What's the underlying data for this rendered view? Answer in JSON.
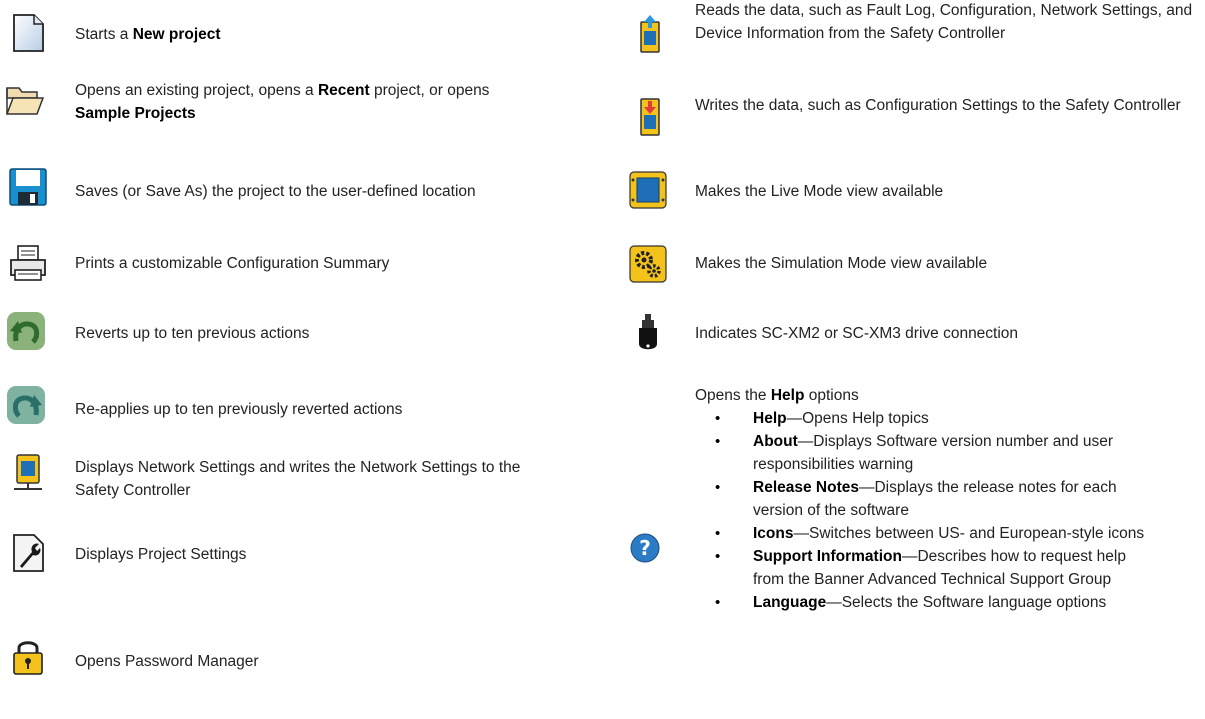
{
  "left": [
    {
      "icon": "new-file-icon",
      "parts": [
        {
          "t": "Starts a "
        },
        {
          "t": "New project",
          "b": true
        }
      ]
    },
    {
      "icon": "open-folder-icon",
      "parts": [
        {
          "t": "Opens an existing project, opens a "
        },
        {
          "t": "Recent",
          "b": true
        },
        {
          "t": " project, or opens "
        },
        {
          "t": "Sample Projects",
          "b": true
        }
      ]
    },
    {
      "icon": "save-disk-icon",
      "parts": [
        {
          "t": "Saves (or Save As) the project to the user-defined location"
        }
      ]
    },
    {
      "icon": "printer-icon",
      "parts": [
        {
          "t": "Prints a customizable Configuration Summary"
        }
      ]
    },
    {
      "icon": "undo-arrow-icon",
      "parts": [
        {
          "t": "Reverts up to ten previous actions"
        }
      ]
    },
    {
      "icon": "redo-arrow-icon",
      "parts": [
        {
          "t": "Re-applies up to ten previously reverted actions"
        }
      ]
    },
    {
      "icon": "network-device-icon",
      "parts": [
        {
          "t": "Displays Network Settings and writes the Network Settings to the Safety Controller"
        }
      ]
    },
    {
      "icon": "wrench-settings-icon",
      "parts": [
        {
          "t": "Displays Project Settings"
        }
      ]
    },
    {
      "icon": "padlock-icon",
      "parts": [
        {
          "t": "Opens Password Manager"
        }
      ]
    }
  ],
  "right": [
    {
      "icon": "read-controller-icon",
      "parts": [
        {
          "t": "Reads the data, such as Fault Log, Configuration, Network Settings, and Device Information from the Safety Controller"
        }
      ]
    },
    {
      "icon": "write-controller-icon",
      "parts": [
        {
          "t": "Writes the data, such as Configuration Settings to the Safety Controller"
        }
      ]
    },
    {
      "icon": "live-mode-icon",
      "parts": [
        {
          "t": "Makes the Live Mode view available"
        }
      ]
    },
    {
      "icon": "simulation-gears-icon",
      "parts": [
        {
          "t": "Makes the Simulation Mode view available"
        }
      ]
    },
    {
      "icon": "usb-drive-icon",
      "parts": [
        {
          "t": "Indicates SC-XM2 or SC-XM3 drive connection"
        }
      ]
    }
  ],
  "help": {
    "icon": "help-question-icon",
    "intro": [
      {
        "t": "Opens the "
      },
      {
        "t": "Help",
        "b": true
      },
      {
        "t": " options"
      }
    ],
    "items": [
      {
        "term": "Help",
        "text": "—Opens Help topics"
      },
      {
        "term": "About",
        "text": "—Displays Software version number and user responsibilities warning"
      },
      {
        "term": "Release Notes",
        "text": "—Displays the release notes for each version of the software"
      },
      {
        "term": "Icons",
        "text": "—Switches between US- and European-style icons"
      },
      {
        "term": "Support Information",
        "text": "—Describes how to request help from the Banner Advanced Technical Support Group"
      },
      {
        "term": "Language",
        "text": "—Selects the Software language options"
      }
    ]
  }
}
